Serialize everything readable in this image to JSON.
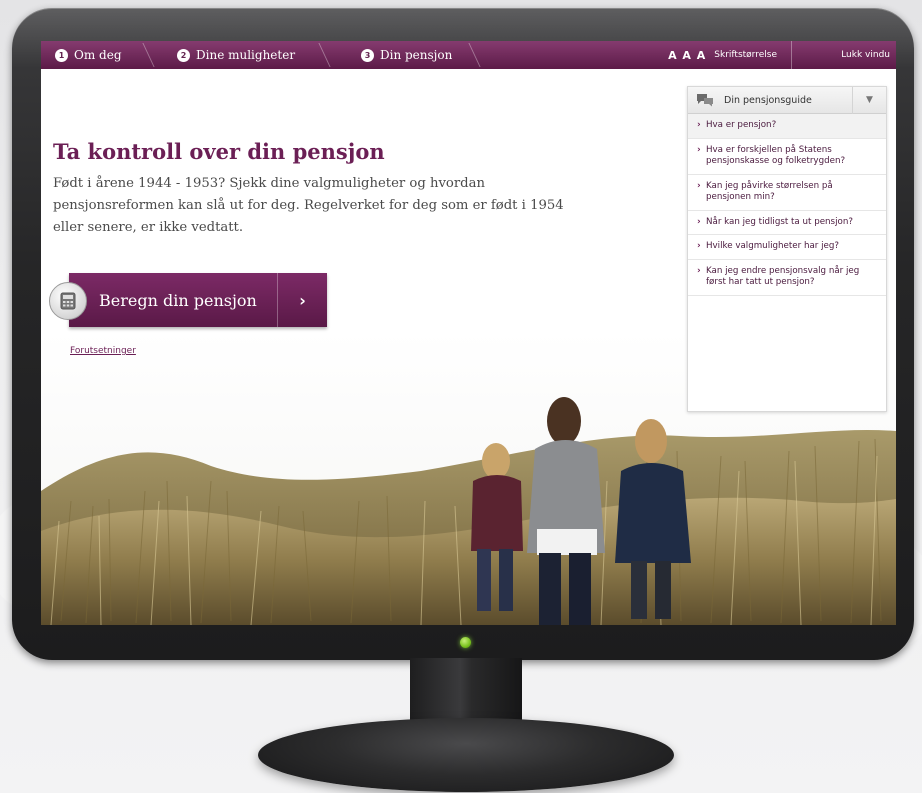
{
  "nav": {
    "steps": [
      {
        "num": "1",
        "label": "Om deg"
      },
      {
        "num": "2",
        "label": "Dine muligheter"
      },
      {
        "num": "3",
        "label": "Din pensjon"
      }
    ],
    "font_size_glyphs": "A A A",
    "font_size_label": "Skriftstørrelse",
    "close_label": "Lukk vindu"
  },
  "main": {
    "headline": "Ta kontroll over din pensjon",
    "intro": "Født i årene 1944 - 1953? Sjekk dine valgmuligheter og hvordan pensjonsreformen kan slå ut for deg. Regelverket for deg som er født i 1954 eller senere, er ikke vedtatt.",
    "cta_label": "Beregn din pensjon",
    "cta_icon": "calculator-icon",
    "prereq_link": "Forutsetninger"
  },
  "guide": {
    "title": "Din pensjonsguide",
    "items": [
      "Hva er pensjon?",
      "Hva er forskjellen på Statens pensjonskasse og folketrygden?",
      "Kan jeg påvirke størrelsen på pensjonen min?",
      "Når kan jeg tidligst ta ut pensjon?",
      "Hvilke valgmuligheter har jeg?",
      "Kan jeg endre pensjonsvalg når jeg først har tatt ut pensjon?"
    ]
  },
  "colors": {
    "brand": "#6b1f55",
    "nav_bar": "#5c1b48",
    "power_led": "#79c21d"
  }
}
